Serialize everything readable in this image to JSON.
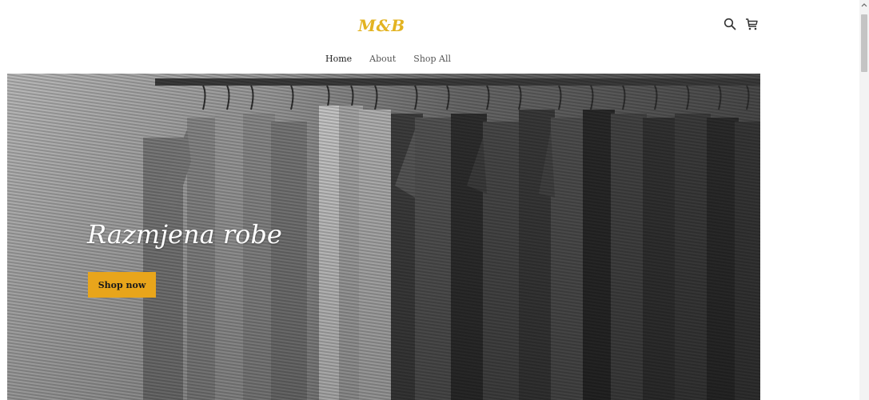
{
  "header": {
    "logo": "M&B",
    "icons": {
      "search": "search-icon",
      "cart": "cart-icon"
    }
  },
  "nav": {
    "items": [
      {
        "label": "Home",
        "active": true
      },
      {
        "label": "About",
        "active": false
      },
      {
        "label": "Shop All",
        "active": false
      }
    ]
  },
  "hero": {
    "title": "Razmjena robe",
    "button_label": "Shop now",
    "image": "clothing-rack-photo"
  },
  "colors": {
    "accent": "#e3b321",
    "button": "#e8a51b"
  }
}
